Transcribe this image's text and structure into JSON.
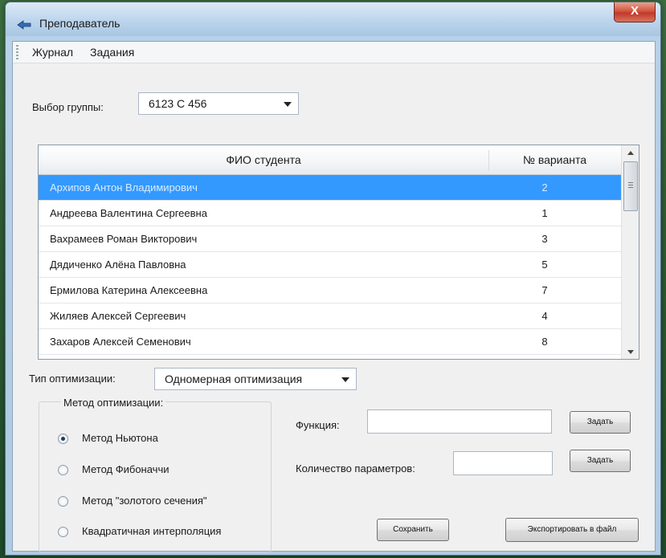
{
  "window": {
    "title": "Преподаватель",
    "close_glyph": "X"
  },
  "menu": {
    "items": [
      "Журнал",
      "Задания"
    ]
  },
  "group": {
    "label": "Выбор группы:",
    "value": "6123 С 456"
  },
  "table": {
    "columns": [
      "ФИО студента",
      "№ варианта"
    ],
    "rows": [
      {
        "fio": "Архипов Антон Владимирович",
        "variant": "2",
        "selected": true
      },
      {
        "fio": "Андреева Валентина Сергеевна",
        "variant": "1"
      },
      {
        "fio": "Вахрамеев Роман Викторович",
        "variant": "3"
      },
      {
        "fio": "Дядиченко Алёна Павловна",
        "variant": "5"
      },
      {
        "fio": "Ермилова Катерина Алексеевна",
        "variant": "7"
      },
      {
        "fio": "Жиляев Алексей Сергеевич",
        "variant": "4"
      },
      {
        "fio": "Захаров Алексей Семенович",
        "variant": "8"
      }
    ]
  },
  "optimization": {
    "label": "Тип оптимизации:",
    "value": "Одномерная оптимизация"
  },
  "method": {
    "title": "Метод оптимизации:",
    "options": [
      {
        "label": "Метод Ньютона",
        "checked": true
      },
      {
        "label": "Метод Фибоначчи",
        "checked": false
      },
      {
        "label": "Метод \"золотого сечения\"",
        "checked": false
      },
      {
        "label": "Квадратичная интерполяция",
        "checked": false
      }
    ]
  },
  "function": {
    "label": "Функция:",
    "value": "",
    "button": "Задать"
  },
  "params": {
    "label": "Количество параметров:",
    "value": "",
    "button": "Задать"
  },
  "actions": {
    "save": "Сохранить",
    "export": "Экспортировать в файл"
  },
  "colors": {
    "selection": "#3399ff",
    "close": "#c0392b"
  },
  "icons": {
    "app": "app-arrow-icon",
    "scroll_up": "scroll-up-icon",
    "scroll_down": "scroll-down-icon"
  }
}
